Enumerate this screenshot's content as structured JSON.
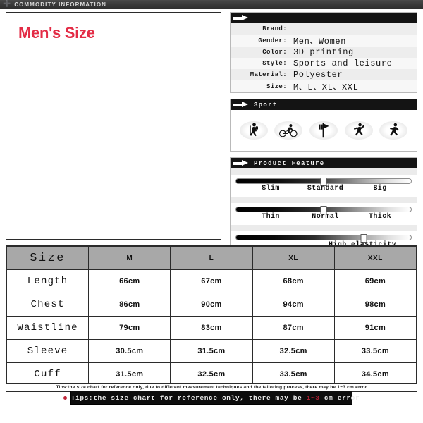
{
  "titlebar": {
    "plus_icon": "plus-icon",
    "title": "COMMODITY INFORMATION"
  },
  "left_panel": {
    "heading": "Men's Size"
  },
  "spec_card": {
    "header_label": "",
    "arrow_icon": "arrow-right-icon",
    "rows": [
      {
        "label": "Brand:",
        "value": ""
      },
      {
        "label": "Gender:",
        "value": "Men、Women"
      },
      {
        "label": "Color:",
        "value": "3D printing"
      },
      {
        "label": "Style:",
        "value": "Sports and leisure"
      },
      {
        "label": "Material:",
        "value": "Polyester"
      },
      {
        "label": "Size:",
        "value": "M、L、XL、XXL"
      }
    ]
  },
  "sport_card": {
    "header_label": "Sport",
    "arrow_icon": "arrow-right-icon",
    "icons": [
      "hiking-icon",
      "cycling-icon",
      "golf-flag-icon",
      "climbing-icon",
      "running-icon"
    ]
  },
  "feature_card": {
    "header_label": "Product Feature",
    "arrow_icon": "arrow-right-icon",
    "sliders": [
      {
        "name": "fit-slider",
        "value_percent": 50,
        "labels": [
          {
            "text": "Slim",
            "pos_percent": 20
          },
          {
            "text": "Standard",
            "pos_percent": 51
          },
          {
            "text": "Big",
            "pos_percent": 82
          }
        ]
      },
      {
        "name": "thickness-slider",
        "value_percent": 50,
        "labels": [
          {
            "text": "Thin",
            "pos_percent": 20
          },
          {
            "text": "Normal",
            "pos_percent": 51
          },
          {
            "text": "Thick",
            "pos_percent": 82
          }
        ]
      },
      {
        "name": "elasticity-slider",
        "value_percent": 73,
        "labels": [
          {
            "text": "High elasticity",
            "pos_percent": 72
          }
        ]
      }
    ]
  },
  "size_chart": {
    "columns": [
      "Size",
      "M",
      "L",
      "XL",
      "XXL"
    ],
    "rows": [
      {
        "label": "Length",
        "values": [
          "66cm",
          "67cm",
          "68cm",
          "69cm"
        ]
      },
      {
        "label": "Chest",
        "values": [
          "86cm",
          "90cm",
          "94cm",
          "98cm"
        ]
      },
      {
        "label": "Waistline",
        "values": [
          "79cm",
          "83cm",
          "87cm",
          "91cm"
        ]
      },
      {
        "label": "Sleeve",
        "values": [
          "30.5cm",
          "31.5cm",
          "32.5cm",
          "33.5cm"
        ]
      },
      {
        "label": "Cuff",
        "values": [
          "31.5cm",
          "32.5cm",
          "33.5cm",
          "34.5cm"
        ]
      }
    ]
  },
  "tips": {
    "line1": "Tips:the size chart for reference only, due to different measurement techniques and the tailoring process, there may be 1~3 cm error",
    "banner_prefix": "Tips:the size chart for reference only,  there may be ",
    "banner_highlight": "1~3",
    "banner_suffix": " cm error",
    "bullet_icon": "red-dot-icon"
  },
  "colors": {
    "accent_red": "#e32b45",
    "banner_red": "#b02032",
    "header_bar": "#141414",
    "table_header": "#a8a8a8"
  }
}
